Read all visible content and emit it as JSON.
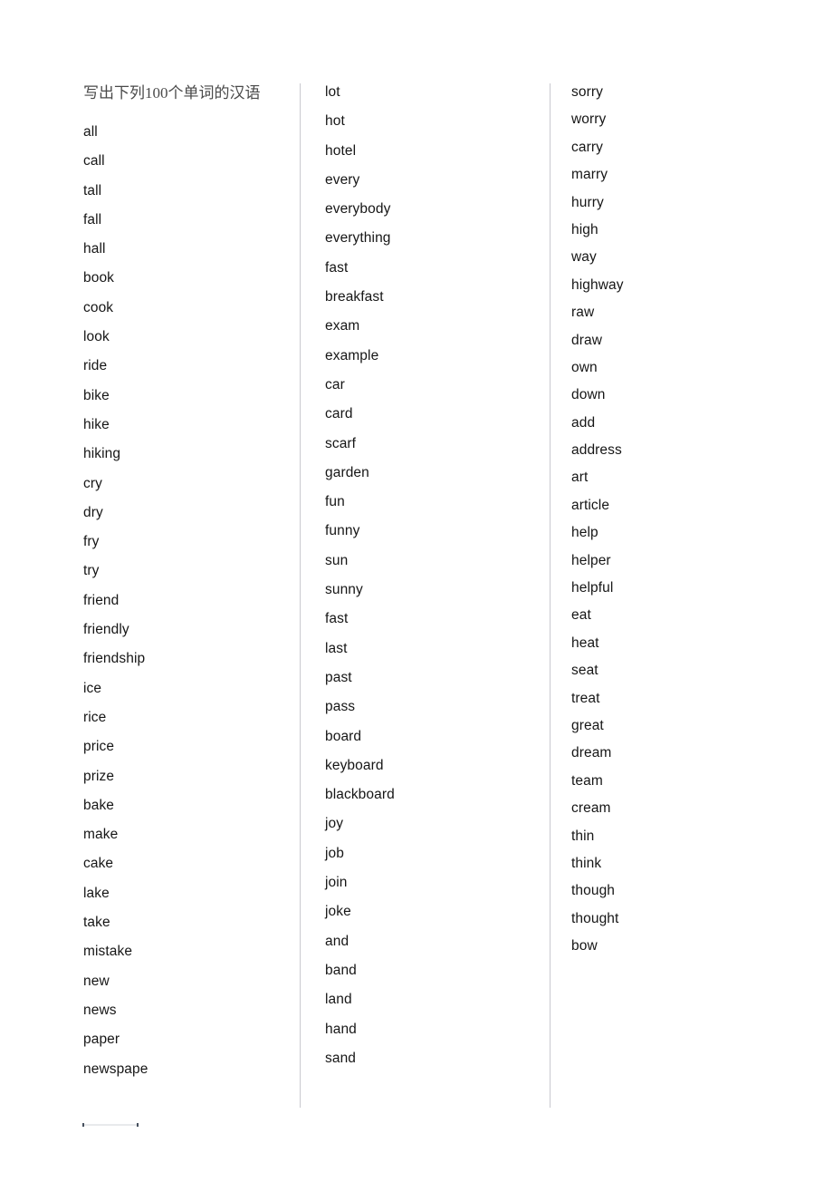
{
  "document": {
    "header": "写出下列100个单词的汉语",
    "divider_color": "#c9c9cf",
    "text_color": "#161616",
    "header_color": "#4a4a4a",
    "background_color": "#ffffff"
  },
  "columns": [
    {
      "id": "col-1",
      "words": [
        "all",
        "call",
        "tall",
        "fall",
        "hall",
        "book",
        "cook",
        "look",
        "ride",
        "bike",
        "hike",
        "hiking",
        "cry",
        "dry",
        "fry",
        "try",
        "friend",
        "friendly",
        "friendship",
        "ice",
        "rice",
        "price",
        "prize",
        "bake",
        "make",
        "cake",
        "lake",
        "take",
        "mistake",
        "new",
        "news",
        "paper",
        "newspape"
      ],
      "gap_before": [
        4,
        8,
        23,
        31
      ]
    },
    {
      "id": "col-2",
      "words": [
        "lot",
        "hot",
        "hotel",
        "every",
        "everybody",
        "everything",
        "fast",
        "breakfast",
        "exam",
        "example",
        "car",
        "card",
        "scarf",
        "garden",
        "fun",
        "funny",
        "sun",
        "sunny",
        "fast",
        "last",
        "past",
        "pass",
        "board",
        "keyboard",
        "blackboard",
        "joy",
        "job",
        "join",
        "joke",
        "and",
        "band",
        "land",
        "hand",
        "sand"
      ],
      "gap_before": [
        1,
        5,
        25,
        32
      ]
    },
    {
      "id": "col-3",
      "words": [
        "sorry",
        "worry",
        "carry",
        "marry",
        "hurry",
        "high",
        "way",
        "highway",
        "raw",
        "draw",
        "own",
        "down",
        "add",
        "address",
        "art",
        "article",
        "help",
        "helper",
        "helpful",
        "eat",
        "heat",
        "seat",
        "treat",
        "great",
        "dream",
        "team",
        "cream",
        "thin",
        "think",
        "though",
        "thought",
        "bow"
      ],
      "gap_before": [
        5,
        26
      ]
    }
  ],
  "footnote_rule": {
    "name": "footnote-separator",
    "cap_color": "#46505e",
    "line_color": "#e8eaec"
  }
}
